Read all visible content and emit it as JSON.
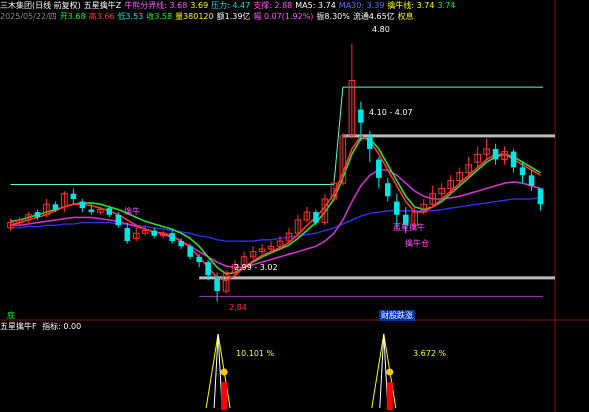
{
  "main_header": {
    "row1": [
      {
        "t": "三木集团(日线 前复权)",
        "c": "w"
      },
      {
        "t": "五星擒牛Z",
        "c": "w"
      },
      {
        "t": "牛熊分界线: 3.68",
        "c": "m"
      },
      {
        "t": "3.69",
        "c": "y"
      },
      {
        "t": "压力: 4.47",
        "c": "c"
      },
      {
        "t": "支撑: 2.88",
        "c": "m"
      },
      {
        "t": "MA5: 3.74",
        "c": "w"
      },
      {
        "t": "MA30: 3.39",
        "c": "b"
      },
      {
        "t": "擒牛线: 3.74",
        "c": "y"
      },
      {
        "t": "3.74",
        "c": "g"
      }
    ],
    "row2": [
      {
        "t": "2025/05/22/四",
        "c": "gr"
      },
      {
        "t": "开3.68",
        "c": "g"
      },
      {
        "t": "高3.66",
        "c": "r"
      },
      {
        "t": "低3.53",
        "c": "c"
      },
      {
        "t": "收3.58",
        "c": "g"
      },
      {
        "t": "量380120",
        "c": "y"
      },
      {
        "t": "额1.39亿",
        "c": "w"
      },
      {
        "t": "幅 0.07(1.92%)",
        "c": "m"
      },
      {
        "t": "振8.30%",
        "c": "w"
      },
      {
        "t": "流通4.65亿",
        "c": "w"
      },
      {
        "t": "权息",
        "c": "y"
      }
    ]
  },
  "sub_header": {
    "title": "五星擒牛F",
    "value": "指标: 0.00"
  },
  "labels": {
    "high_price": "4.80",
    "zone_upper": "4.10 - 4.07",
    "zone_lower": "2.99 - 3.02",
    "low_price": "2.84",
    "signal_a": "擒牛",
    "signal_b": "蓝星擒牛",
    "signal_c": "擒牛仓",
    "bottom_left": "底",
    "bottom_mid": "财股跌涨",
    "pct_a": "10.101 %",
    "pct_b": "3.672 %"
  },
  "colors": {
    "up": "#ff3333",
    "down": "#00e5e5",
    "bg": "#000000"
  },
  "chart_data": {
    "type": "candlestick",
    "title": "",
    "ylim": [
      2.7,
      4.95
    ],
    "candles": [
      [
        3.4,
        3.44,
        3.47,
        3.38
      ],
      [
        3.44,
        3.46,
        3.48,
        3.42
      ],
      [
        3.46,
        3.5,
        3.52,
        3.44
      ],
      [
        3.52,
        3.48,
        3.54,
        3.46
      ],
      [
        3.5,
        3.58,
        3.62,
        3.48
      ],
      [
        3.58,
        3.54,
        3.6,
        3.52
      ],
      [
        3.56,
        3.66,
        3.68,
        3.52
      ],
      [
        3.66,
        3.62,
        3.7,
        3.58
      ],
      [
        3.6,
        3.55,
        3.62,
        3.52
      ],
      [
        3.54,
        3.52,
        3.58,
        3.5
      ],
      [
        3.52,
        3.54,
        3.56,
        3.5
      ],
      [
        3.55,
        3.5,
        3.57,
        3.48
      ],
      [
        3.5,
        3.42,
        3.52,
        3.4
      ],
      [
        3.4,
        3.3,
        3.44,
        3.28
      ],
      [
        3.32,
        3.36,
        3.4,
        3.3
      ],
      [
        3.36,
        3.38,
        3.42,
        3.34
      ],
      [
        3.38,
        3.34,
        3.4,
        3.32
      ],
      [
        3.34,
        3.36,
        3.38,
        3.32
      ],
      [
        3.36,
        3.3,
        3.38,
        3.28
      ],
      [
        3.3,
        3.26,
        3.32,
        3.24
      ],
      [
        3.26,
        3.18,
        3.28,
        3.16
      ],
      [
        3.18,
        3.14,
        3.2,
        3.1
      ],
      [
        3.14,
        3.04,
        3.16,
        3.0
      ],
      [
        3.02,
        2.92,
        3.06,
        2.84
      ],
      [
        2.92,
        3.06,
        3.08,
        2.9
      ],
      [
        3.06,
        3.12,
        3.16,
        3.04
      ],
      [
        3.12,
        3.18,
        3.22,
        3.1
      ],
      [
        3.18,
        3.22,
        3.26,
        3.16
      ],
      [
        3.22,
        3.24,
        3.28,
        3.2
      ],
      [
        3.24,
        3.26,
        3.3,
        3.22
      ],
      [
        3.26,
        3.3,
        3.34,
        3.24
      ],
      [
        3.3,
        3.36,
        3.4,
        3.28
      ],
      [
        3.36,
        3.46,
        3.5,
        3.34
      ],
      [
        3.46,
        3.52,
        3.56,
        3.44
      ],
      [
        3.52,
        3.44,
        3.54,
        3.42
      ],
      [
        3.44,
        3.62,
        3.66,
        3.42
      ],
      [
        3.62,
        3.74,
        3.78,
        3.6
      ],
      [
        3.74,
        4.1,
        4.12,
        3.72
      ],
      [
        4.1,
        4.52,
        4.8,
        4.08
      ],
      [
        4.3,
        4.2,
        4.36,
        4.06
      ],
      [
        4.1,
        4.0,
        4.14,
        3.9
      ],
      [
        3.92,
        3.78,
        3.94,
        3.7
      ],
      [
        3.74,
        3.64,
        3.78,
        3.6
      ],
      [
        3.6,
        3.5,
        3.66,
        3.4
      ],
      [
        3.5,
        3.42,
        3.56,
        3.36
      ],
      [
        3.42,
        3.52,
        3.56,
        3.4
      ],
      [
        3.52,
        3.58,
        3.62,
        3.5
      ],
      [
        3.58,
        3.66,
        3.72,
        3.56
      ],
      [
        3.66,
        3.7,
        3.74,
        3.62
      ],
      [
        3.7,
        3.76,
        3.8,
        3.66
      ],
      [
        3.76,
        3.82,
        3.86,
        3.72
      ],
      [
        3.82,
        3.88,
        3.94,
        3.78
      ],
      [
        3.9,
        3.96,
        4.02,
        3.86
      ],
      [
        3.96,
        4.0,
        4.08,
        3.92
      ],
      [
        4.0,
        3.92,
        4.04,
        3.88
      ],
      [
        3.92,
        3.98,
        4.02,
        3.88
      ],
      [
        3.98,
        3.86,
        4.0,
        3.82
      ],
      [
        3.86,
        3.8,
        3.9,
        3.74
      ],
      [
        3.8,
        3.72,
        3.84,
        3.68
      ],
      [
        3.7,
        3.58,
        3.66,
        3.53
      ]
    ],
    "ma_red": [
      3.42,
      3.44,
      3.46,
      3.48,
      3.5,
      3.53,
      3.56,
      3.58,
      3.58,
      3.57,
      3.55,
      3.53,
      3.5,
      3.46,
      3.42,
      3.39,
      3.37,
      3.36,
      3.34,
      3.3,
      3.25,
      3.18,
      3.1,
      3.02,
      3.0,
      3.04,
      3.1,
      3.15,
      3.19,
      3.22,
      3.25,
      3.29,
      3.35,
      3.42,
      3.48,
      3.56,
      3.66,
      3.82,
      4.0,
      4.1,
      4.06,
      3.96,
      3.84,
      3.72,
      3.6,
      3.52,
      3.52,
      3.56,
      3.62,
      3.68,
      3.74,
      3.8,
      3.86,
      3.92,
      3.96,
      3.96,
      3.92,
      3.88,
      3.84,
      3.8
    ],
    "ma_green": [
      3.45,
      3.46,
      3.48,
      3.5,
      3.52,
      3.54,
      3.56,
      3.58,
      3.59,
      3.59,
      3.58,
      3.56,
      3.54,
      3.51,
      3.48,
      3.45,
      3.43,
      3.41,
      3.39,
      3.36,
      3.32,
      3.26,
      3.18,
      3.1,
      3.05,
      3.06,
      3.1,
      3.14,
      3.18,
      3.21,
      3.24,
      3.27,
      3.32,
      3.38,
      3.44,
      3.52,
      3.62,
      3.78,
      3.96,
      4.08,
      4.08,
      4.0,
      3.88,
      3.76,
      3.64,
      3.56,
      3.54,
      3.56,
      3.6,
      3.66,
      3.72,
      3.78,
      3.84,
      3.9,
      3.94,
      3.96,
      3.94,
      3.9,
      3.86,
      3.82
    ],
    "ma_magenta": [
      3.42,
      3.42,
      3.43,
      3.44,
      3.45,
      3.46,
      3.47,
      3.48,
      3.48,
      3.48,
      3.47,
      3.46,
      3.45,
      3.43,
      3.41,
      3.39,
      3.37,
      3.35,
      3.33,
      3.3,
      3.26,
      3.22,
      3.18,
      3.14,
      3.11,
      3.1,
      3.1,
      3.12,
      3.14,
      3.16,
      3.18,
      3.2,
      3.22,
      3.24,
      3.26,
      3.3,
      3.36,
      3.46,
      3.6,
      3.72,
      3.8,
      3.84,
      3.84,
      3.8,
      3.74,
      3.68,
      3.64,
      3.62,
      3.62,
      3.63,
      3.64,
      3.66,
      3.68,
      3.7,
      3.72,
      3.74,
      3.75,
      3.74,
      3.72,
      3.7
    ],
    "ma_blue": [
      3.4,
      3.4,
      3.41,
      3.41,
      3.42,
      3.42,
      3.43,
      3.43,
      3.44,
      3.44,
      3.44,
      3.44,
      3.43,
      3.43,
      3.42,
      3.41,
      3.4,
      3.39,
      3.38,
      3.37,
      3.36,
      3.34,
      3.33,
      3.31,
      3.3,
      3.3,
      3.3,
      3.3,
      3.31,
      3.31,
      3.32,
      3.33,
      3.34,
      3.35,
      3.36,
      3.38,
      3.4,
      3.43,
      3.46,
      3.49,
      3.51,
      3.52,
      3.53,
      3.53,
      3.53,
      3.53,
      3.53,
      3.53,
      3.54,
      3.55,
      3.56,
      3.57,
      3.58,
      3.59,
      3.6,
      3.61,
      3.62,
      3.62,
      3.62,
      3.63
    ],
    "levels": {
      "top_cyan_seg": [
        3.73,
        4.47
      ],
      "pressure": 4.47,
      "zone_upper": 4.1,
      "zone_lower": 3.02,
      "support": 2.88
    }
  }
}
